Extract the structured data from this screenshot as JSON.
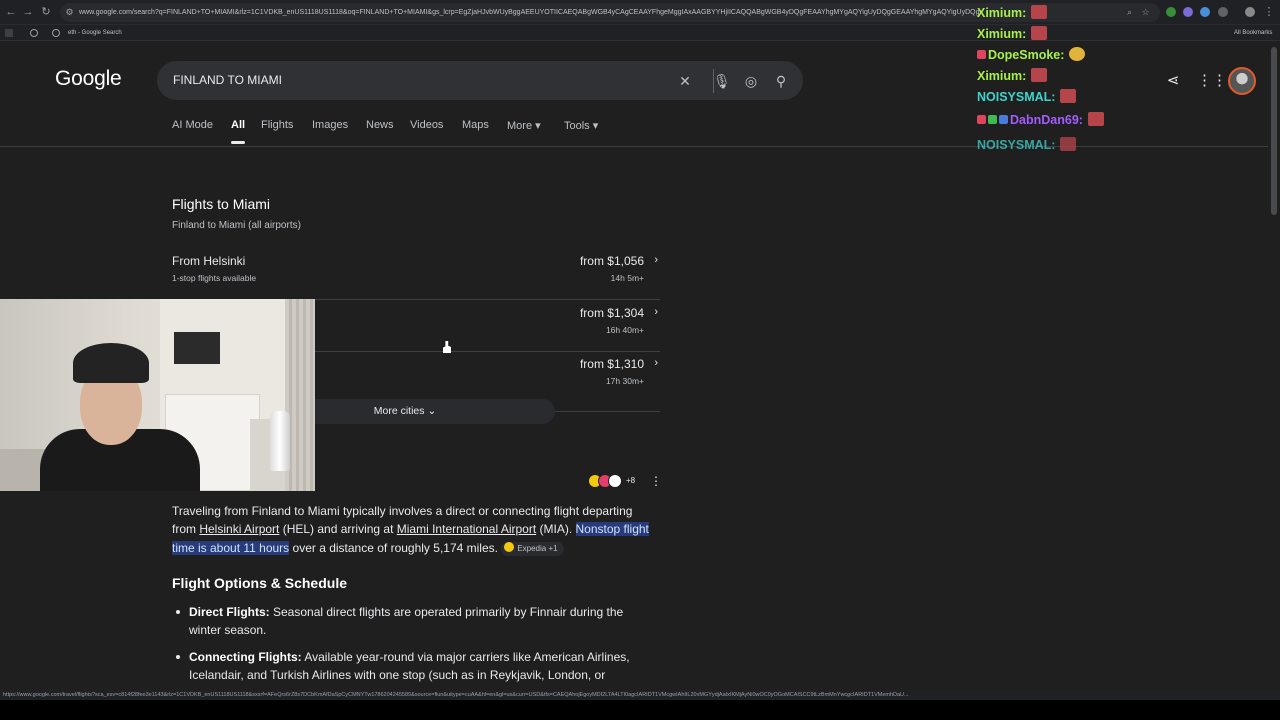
{
  "browser": {
    "url": "www.google.com/search?q=FINLAND+TO+MIAMI&rlz=1C1VDKB_enUS1118US1118&oq=FINLAND+TO+MIAMI&gs_lcrp=EgZjaHJvbWUyBggAEEUYOTIICAEQABgWGB4yCAgCEAAYFhgeMggIAxAAGBYYHjIICAQQABgWGB4yDQgFEAAYhgMYgAQYigUyDQgGEAAYhgMYgAQYigUyDQgHEAAYhgMYgAQYigUyDQgIEAAYhgMYgAQYigUyDQgJEAAYhgMYgAQYigUyDQgKEAAYhgMYgAQYigUyDQgLEAAYhgMYgAQYigUyDQgMEAAYhgMYgAQYigUyDQgNEAAYhgMYgAQYigUyDQgOEAAYhgMYgAQYigUyDQgPEAAYhgMYgAQYigUy...gzODk4ajBqNGC...",
    "bookmark_tab": "eth - Google Search",
    "bookmarks_label": "All Bookmarks",
    "status_url": "https://www.google.com/travel/flights?sca_esv=c814f28fee3e1143&rlz=1C1VDKB_enUS1118US1118&sxsrf=AFeQrs6rZ8s7DCbKmAfDaSpCyCMNYTw1786204245589&source=flun&uitype=cuAA&hl=en&gl=us&curr=USD&tfs=CAEQAhojEgoyMDI2LTA4LTI0agcIARIDT1VMcgwIAhIIL20vMGYydjAaIxIKMjAyNi0wOC0yOGoMCAISCC9tLzBmMnYwcgcIARIDT1VMemhDaU..."
  },
  "google": {
    "logo": "Google",
    "query": "FINLAND TO MIAMI",
    "tabs": [
      {
        "label": "AI Mode"
      },
      {
        "label": "All"
      },
      {
        "label": "Flights"
      },
      {
        "label": "Images"
      },
      {
        "label": "News"
      },
      {
        "label": "Videos"
      },
      {
        "label": "Maps"
      },
      {
        "label": "More ▾"
      },
      {
        "label": "Tools ▾"
      }
    ]
  },
  "flights": {
    "title": "Flights to Miami",
    "subtitle": "Finland to Miami (all airports)",
    "rows": [
      {
        "from": "From Helsinki",
        "stops": "1-stop flights available",
        "price": "from $1,056",
        "duration": "14h 5m+"
      },
      {
        "from": "",
        "stops": "",
        "price": "from $1,304",
        "duration": "16h 40m+"
      },
      {
        "from": "",
        "stops": "",
        "price": "from $1,310",
        "duration": "17h 30m+"
      }
    ],
    "more_label": "More cities"
  },
  "ai_overview": {
    "source_count": "+8",
    "para_1": "Traveling from Finland to Miami typically involves a direct or connecting flight departing from ",
    "link_1": "Helsinki Airport",
    "para_2": " (HEL) and arriving at ",
    "link_2": "Miami International Airport",
    "para_3": " (MIA). ",
    "highlight": "Nonstop flight time is about 11 hours",
    "para_4": " over a distance of roughly 5,174 miles. ",
    "chip": "Expedia +1",
    "heading": "Flight Options & Schedule",
    "bullets": [
      {
        "term": "Direct Flights:",
        "text": " Seasonal direct flights are operated primarily by Finnair during the winter season."
      },
      {
        "term": "Connecting Flights:",
        "text": " Available year-round via major carriers like American Airlines, Icelandair, and Turkish Airlines with one stop (such as in Reykjavik, London, or"
      }
    ]
  },
  "chat": [
    {
      "user": "Ximium:",
      "color": "#a8f04a"
    },
    {
      "user": "Ximium:",
      "color": "#a8f04a"
    },
    {
      "user": "DopeSmoke:",
      "color": "#a8f04a"
    },
    {
      "user": "Ximium:",
      "color": "#a8f04a"
    },
    {
      "user": "NOISYSMAL:",
      "color": "#3fd3ce"
    },
    {
      "user": "DabnDan69:",
      "color": "#a35cff"
    },
    {
      "user": "NOISYSMAL:",
      "color": "#3fd3ce"
    }
  ],
  "colors": {
    "background": "#1f1f1f",
    "search_box": "#303134",
    "highlight": "#273a7a",
    "accent_orange": "#e05a2a"
  }
}
